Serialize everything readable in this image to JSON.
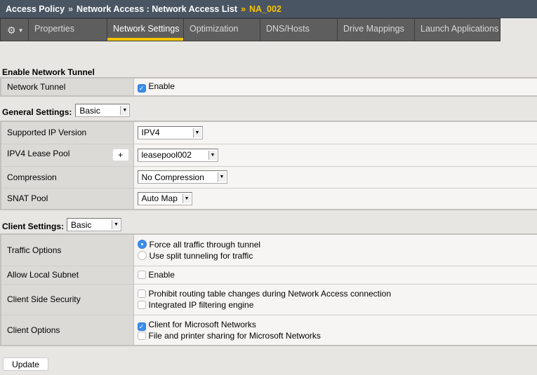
{
  "breadcrumb": {
    "items": [
      "Access Policy",
      "Network Access : Network Access List"
    ],
    "current": "NA_002",
    "separator": "»"
  },
  "tabs": {
    "gear_icon": "gear-icon",
    "items": [
      {
        "label": "Properties",
        "active": false
      },
      {
        "label": "Network Settings",
        "active": true
      },
      {
        "label": "Optimization",
        "active": false
      },
      {
        "label": "DNS/Hosts",
        "active": false
      },
      {
        "label": "Drive Mappings",
        "active": false
      },
      {
        "label": "Launch Applications",
        "active": false
      }
    ]
  },
  "tunnel": {
    "heading": "Enable Network Tunnel",
    "row_label": "Network Tunnel",
    "checkbox_label": "Enable",
    "checked": true
  },
  "general": {
    "heading": "General Settings:",
    "mode": "Basic",
    "rows": {
      "ip_version": {
        "label": "Supported IP Version",
        "value": "IPV4"
      },
      "lease_pool": {
        "label": "IPV4 Lease Pool",
        "value": "leasepool002",
        "add_label": "+"
      },
      "compression": {
        "label": "Compression",
        "value": "No Compression"
      },
      "snat": {
        "label": "SNAT Pool",
        "value": "Auto Map"
      }
    }
  },
  "client": {
    "heading": "Client Settings:",
    "mode": "Basic",
    "traffic": {
      "label": "Traffic Options",
      "options": [
        "Force all traffic through tunnel",
        "Use split tunneling for traffic"
      ],
      "selected": 0
    },
    "local_subnet": {
      "label": "Allow Local Subnet",
      "checkbox_label": "Enable",
      "checked": false
    },
    "security": {
      "label": "Client Side Security",
      "options": [
        {
          "label": "Prohibit routing table changes during Network Access connection",
          "checked": false
        },
        {
          "label": "Integrated IP filtering engine",
          "checked": false
        }
      ]
    },
    "options": {
      "label": "Client Options",
      "options": [
        {
          "label": "Client for Microsoft Networks",
          "checked": true
        },
        {
          "label": "File and printer sharing for Microsoft Networks",
          "checked": false
        }
      ]
    }
  },
  "update_label": "Update",
  "colors": {
    "accent": "#f5c400",
    "titlebar": "#4a5563",
    "checkbox": "#3b8eea"
  }
}
